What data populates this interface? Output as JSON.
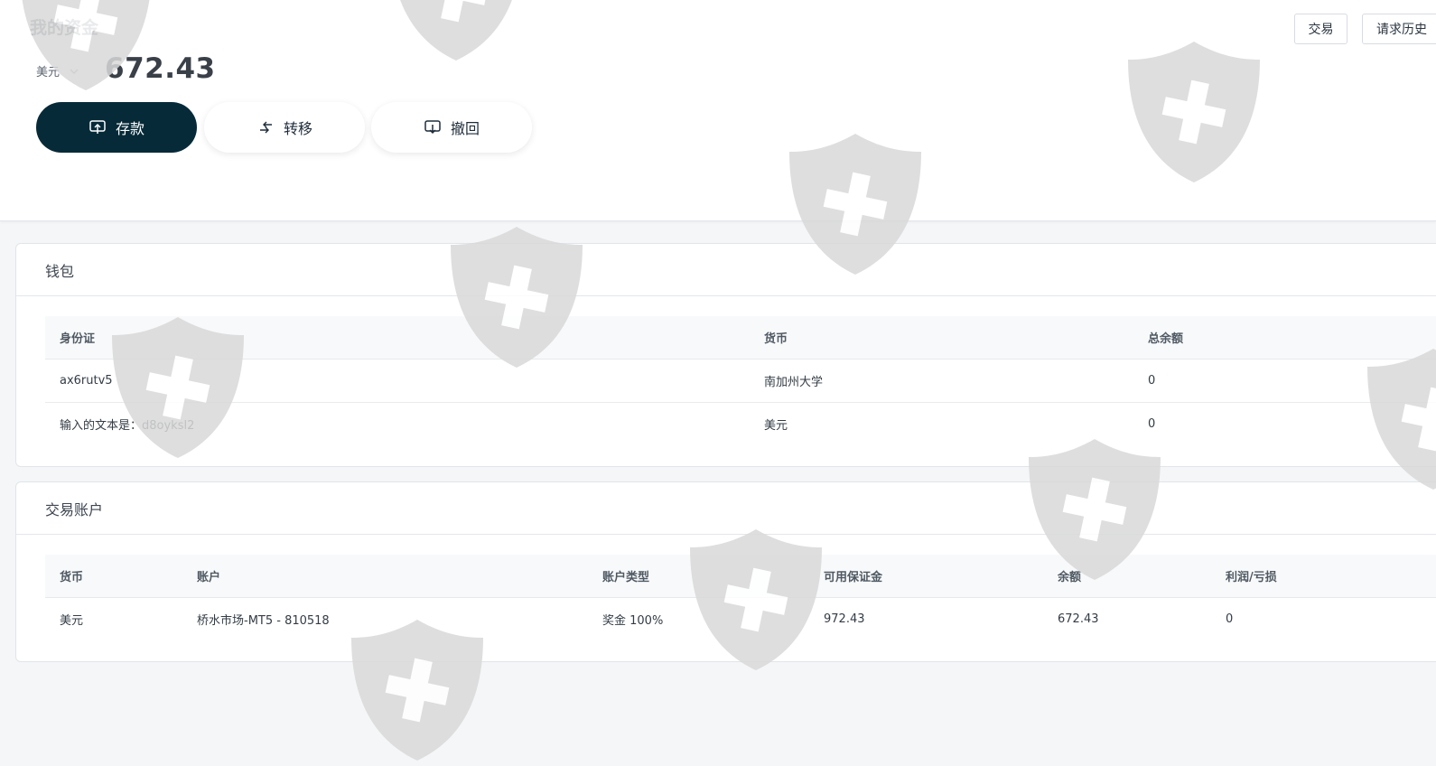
{
  "header": {
    "title": "我的资金",
    "currency": "美元",
    "balance": "672.43",
    "actions": {
      "deposit": "存款",
      "transfer": "转移",
      "withdraw": "撤回"
    },
    "links": {
      "trades": "交易",
      "history": "请求历史"
    }
  },
  "wallet": {
    "title": "钱包",
    "columns": [
      "身份证",
      "货币",
      "总余额"
    ],
    "rows": [
      {
        "id": "ax6rutv5",
        "currency": "南加州大学",
        "total": "0"
      },
      {
        "id": "输入的文本是：d8oyksl2",
        "currency": "美元",
        "total": "0"
      }
    ]
  },
  "accounts": {
    "title": "交易账户",
    "columns": [
      "货币",
      "账户",
      "账户类型",
      "可用保证金",
      "余额",
      "利润/亏损"
    ],
    "rows": [
      {
        "currency": "美元",
        "account": "桥水市场-MT5 - 810518",
        "type": "奖金 100%",
        "free_margin": "972.43",
        "balance": "672.43",
        "pnl": "0"
      }
    ]
  },
  "colors": {
    "primary": "#062a38",
    "watermark": "#d9d9d9"
  }
}
